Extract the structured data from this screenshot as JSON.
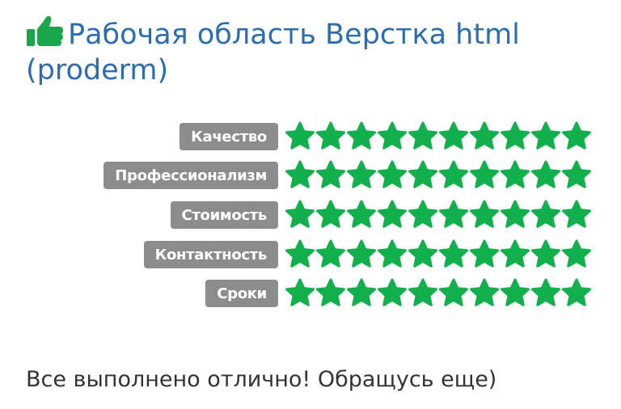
{
  "header": {
    "icon": "thumbs-up-icon",
    "title": "Рабочая область Верстка html (proderm)"
  },
  "colors": {
    "title": "#2a6db5",
    "icon": "#1aa64a",
    "star": "#12b04d",
    "label_bg": "#8c8c8c",
    "comment": "#333333"
  },
  "ratings": [
    {
      "label": "Качество",
      "stars": 10,
      "max": 10
    },
    {
      "label": "Профессионализм",
      "stars": 10,
      "max": 10
    },
    {
      "label": "Стоимость",
      "stars": 10,
      "max": 10
    },
    {
      "label": "Контактность",
      "stars": 10,
      "max": 10
    },
    {
      "label": "Сроки",
      "stars": 10,
      "max": 10
    }
  ],
  "comment": "Все выполнено отлично! Обращусь еще)"
}
